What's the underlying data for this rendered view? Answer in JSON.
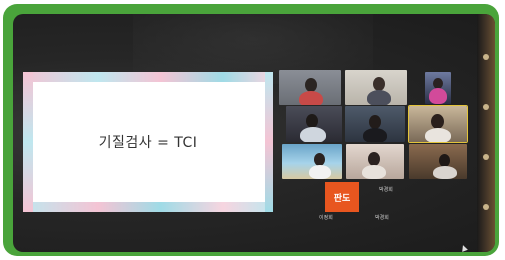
{
  "slide": {
    "title": "기질검사 = TCI"
  },
  "gallery": {
    "orange_tile_text": "판도",
    "tile_names": [
      "",
      "",
      "",
      "",
      "",
      "",
      "",
      "",
      "",
      ""
    ],
    "bottom_name": "박경희",
    "bottom_caption_left": "이정희",
    "bottom_caption_right": "박경희"
  },
  "colors": {
    "frame": "#4aa43b",
    "orange_tile": "#e8561f",
    "active_speaker": "#e3c43a"
  }
}
